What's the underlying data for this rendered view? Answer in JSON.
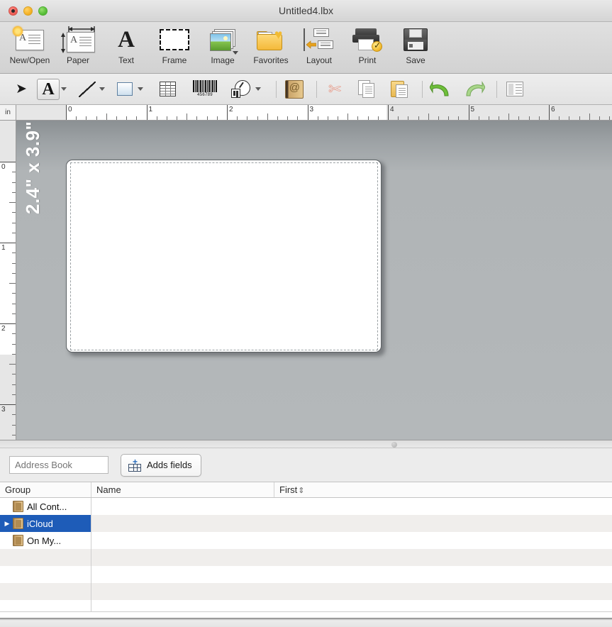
{
  "window": {
    "title": "Untitled4.lbx",
    "traffic_lights": [
      "close-button",
      "minimize-button",
      "zoom-button"
    ]
  },
  "main_toolbar": {
    "items": [
      {
        "label": "New/Open",
        "icon": "new-open-icon"
      },
      {
        "label": "Paper",
        "icon": "paper-icon"
      },
      {
        "label": "Text",
        "icon": "text-icon"
      },
      {
        "label": "Frame",
        "icon": "frame-icon"
      },
      {
        "label": "Image",
        "icon": "image-icon"
      },
      {
        "label": "Favorites",
        "icon": "favorites-icon"
      },
      {
        "label": "Layout",
        "icon": "layout-icon"
      },
      {
        "label": "Print",
        "icon": "print-icon"
      },
      {
        "label": "Save",
        "icon": "save-icon"
      }
    ]
  },
  "secondary_toolbar": {
    "tools": [
      {
        "name": "select-arrow-icon",
        "has_caret": false,
        "selected": false
      },
      {
        "name": "text-tool-icon",
        "has_caret": true,
        "selected": true
      },
      {
        "name": "line-tool-icon",
        "has_caret": true,
        "selected": false
      },
      {
        "name": "rectangle-tool-icon",
        "has_caret": true,
        "selected": false
      },
      {
        "name": "table-tool-icon",
        "has_caret": false,
        "selected": false
      },
      {
        "name": "barcode-tool-icon",
        "has_caret": false,
        "selected": false
      },
      {
        "name": "clipart-tool-icon",
        "has_caret": true,
        "selected": false
      },
      {
        "name": "address-book-icon",
        "has_caret": false,
        "selected": false
      },
      {
        "name": "cut-icon",
        "has_caret": false,
        "selected": false
      },
      {
        "name": "copy-icon",
        "has_caret": false,
        "selected": false
      },
      {
        "name": "paste-icon",
        "has_caret": false,
        "selected": false
      },
      {
        "name": "undo-icon",
        "has_caret": false,
        "selected": false
      },
      {
        "name": "redo-icon",
        "has_caret": false,
        "selected": false
      },
      {
        "name": "inspector-icon",
        "has_caret": false,
        "selected": false
      }
    ],
    "barcode_digits": "456789"
  },
  "rulers": {
    "unit": "in",
    "horizontal_ticks": [
      "0",
      "1",
      "2",
      "3",
      "4",
      "5",
      "6"
    ],
    "vertical_ticks": [
      "0",
      "1",
      "2",
      "3"
    ]
  },
  "canvas": {
    "label_size_text": "2.4\" x 3.9\"",
    "background_color": "#b0b4b6"
  },
  "database_bar": {
    "address_book_placeholder": "Address Book",
    "address_book_value": "",
    "add_fields_label": "Adds fields"
  },
  "table": {
    "columns": [
      {
        "header": "Group",
        "sortable": false
      },
      {
        "header": "Name",
        "sortable": false
      },
      {
        "header": "First",
        "sortable": true,
        "sort_indicator": "⇕"
      }
    ],
    "groups": [
      {
        "label": "All Cont...",
        "selected": false,
        "expandable": false,
        "row": 0
      },
      {
        "label": "iCloud",
        "selected": true,
        "expandable": true,
        "row": 1
      },
      {
        "label": "On My...",
        "selected": false,
        "expandable": false,
        "row": 2
      }
    ],
    "row_count": 7,
    "rows": []
  },
  "colors": {
    "selection_blue": "#1e5cb8",
    "row_stripe": "#f0eeec",
    "canvas_gray": "#b0b4b6"
  }
}
